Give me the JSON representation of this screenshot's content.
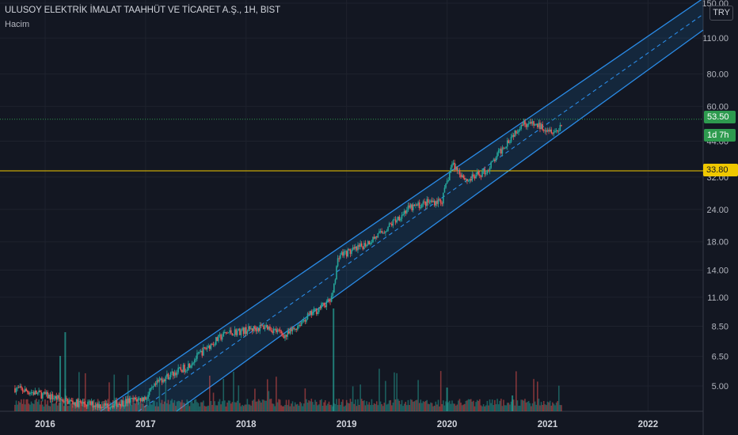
{
  "header": {
    "symbol_line": "ULUSOY ELEKTRİK İMALAT TAAHHÜT VE TİCARET A.Ş., 1H, BIST",
    "volume_label": "Hacim"
  },
  "currency_button": "TRY",
  "tags": {
    "last_price": "53.50",
    "countdown": "1d 7h",
    "horizontal_level": "33.80"
  },
  "colors": {
    "background": "#131722",
    "grid": "#1e222d",
    "up": "#26a69a",
    "down": "#ef5350",
    "channel": "#2a8be6",
    "channel_fill": "rgba(33,150,243,0.13)",
    "level_line": "#f0c800",
    "last_price_line": "#2e9b4f"
  },
  "chart_data": {
    "type": "candlestick",
    "y_scale": "log",
    "y_ticks": [
      "150.00",
      "110.00",
      "80.00",
      "60.00",
      "44.00",
      "32.00",
      "24.00",
      "18.00",
      "14.00",
      "11.00",
      "8.50",
      "6.50",
      "5.00"
    ],
    "x_ticks": [
      "2016",
      "2017",
      "2018",
      "2019",
      "2020",
      "2021",
      "2022"
    ],
    "horizontal_level": 33.8,
    "last_price": 53.5,
    "price_path": [
      {
        "t": 2015.7,
        "p": 4.9
      },
      {
        "t": 2016.0,
        "p": 4.6
      },
      {
        "t": 2016.3,
        "p": 4.3
      },
      {
        "t": 2016.6,
        "p": 4.2
      },
      {
        "t": 2017.0,
        "p": 4.5
      },
      {
        "t": 2017.15,
        "p": 5.3
      },
      {
        "t": 2017.4,
        "p": 5.9
      },
      {
        "t": 2017.6,
        "p": 7.0
      },
      {
        "t": 2017.8,
        "p": 8.0
      },
      {
        "t": 2018.0,
        "p": 8.2
      },
      {
        "t": 2018.2,
        "p": 8.5
      },
      {
        "t": 2018.4,
        "p": 7.8
      },
      {
        "t": 2018.6,
        "p": 9.2
      },
      {
        "t": 2018.85,
        "p": 10.8
      },
      {
        "t": 2018.92,
        "p": 16.0
      },
      {
        "t": 2019.1,
        "p": 16.8
      },
      {
        "t": 2019.35,
        "p": 19.5
      },
      {
        "t": 2019.6,
        "p": 24.0
      },
      {
        "t": 2019.8,
        "p": 25.5
      },
      {
        "t": 2019.95,
        "p": 26.0
      },
      {
        "t": 2020.05,
        "p": 36.0
      },
      {
        "t": 2020.2,
        "p": 31.0
      },
      {
        "t": 2020.4,
        "p": 34.0
      },
      {
        "t": 2020.6,
        "p": 44.0
      },
      {
        "t": 2020.75,
        "p": 52.0
      },
      {
        "t": 2020.95,
        "p": 50.0
      },
      {
        "t": 2021.1,
        "p": 48.0
      },
      {
        "t": 2021.15,
        "p": 53.5
      }
    ],
    "regression_channel": {
      "start_t": 2016.55,
      "upper_start": 4.4,
      "upper_slope_per_year": 0.54,
      "lower_start": 4.4,
      "lower_offset": -0.58
    }
  }
}
